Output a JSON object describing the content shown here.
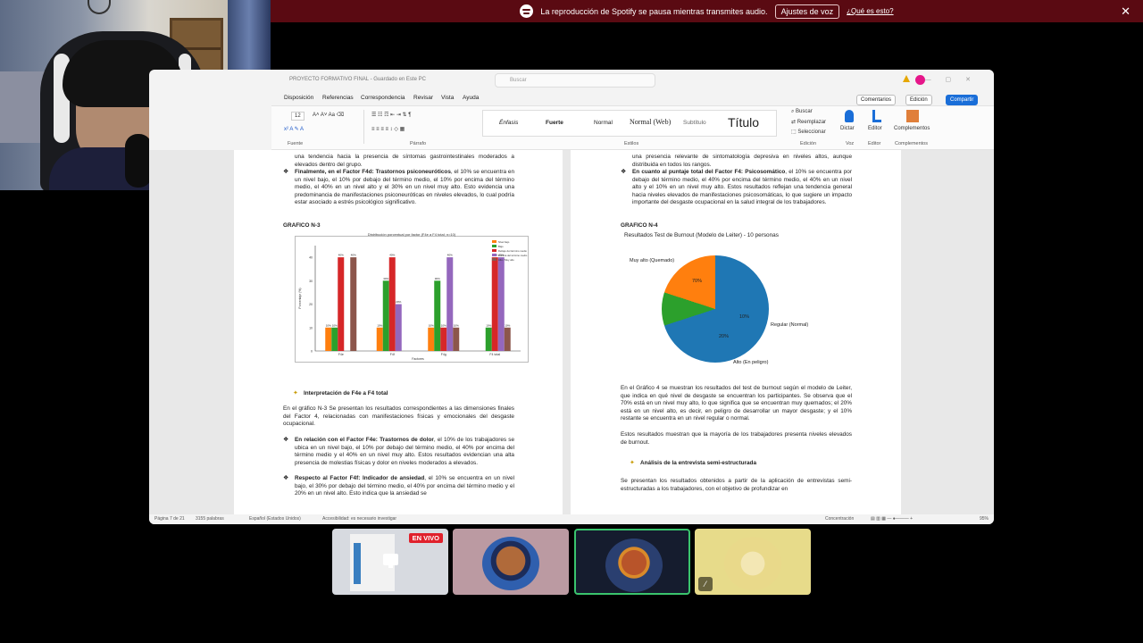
{
  "banner": {
    "message": "La reproducción de Spotify se pausa mientras transmites audio.",
    "voice_settings": "Ajustes de voz",
    "whats_this": "¿Qué es esto?"
  },
  "word": {
    "doc_title": "PROYECTO FORMATIVO FINAL - Guardado en Este PC",
    "search_placeholder": "Buscar",
    "menu": [
      "Disposición",
      "Referencias",
      "Correspondencia",
      "Revisar",
      "Vista",
      "Ayuda"
    ],
    "comments": "Comentarios",
    "editing": "Edición",
    "share": "Compartir",
    "ribbon": {
      "font_size": "12",
      "group_font": "Fuente",
      "group_paragraph": "Párrafo",
      "group_styles": "Estilos",
      "group_editing": "Edición",
      "group_voice": "Voz",
      "group_editor": "Editor",
      "group_addins": "Complementos",
      "styles": [
        "Énfasis",
        "Fuerte",
        "Normal",
        "Normal (Web)",
        "Subtítulo",
        "Título"
      ],
      "find": "Buscar",
      "replace": "Reemplazar",
      "select": "Seleccionar",
      "dictate": "Dictar",
      "editor": "Editor",
      "addins": "Complementos"
    },
    "left_page": {
      "p1": "una tendencia hacia la presencia de síntomas gastrointestinales moderados a elevados dentro del grupo.",
      "p2_bold": "Finalmente, en el Factor F4d: Trastornos psiconeuróticos",
      "p2": ", el 10% se encuentra en un nivel bajo, el 10% por debajo del término medio, el 10% por encima del término medio, el 40% en un nivel alto y el 30% en un nivel muy alto. Esto evidencia una predominancia de manifestaciones psiconeuróticas en niveles elevados, lo cual podría estar asociado a estrés psicológico significativo.",
      "graph_label": "GRAFICO N-3",
      "chart_title": "Distribución porcentual por factor (F4e a F4 total; n=10)",
      "interp_title": "Interpretación de F4e a F4 total",
      "p3": "En el gráfico N-3 Se presentan los resultados correspondientes a las dimensiones finales del Factor 4, relacionadas con manifestaciones físicas y emocionales del desgaste ocupacional.",
      "p4_bold": "En relación con el Factor F4e: Trastornos de dolor",
      "p4": ", el 10% de los trabajadores se ubica en un nivel bajo, el 10% por debajo del término medio, el 40% por encima del término medio y el 40% en un nivel muy alto. Estos resultados evidencian una alta presencia de molestias físicas y dolor en niveles moderados a elevados.",
      "p5_bold": "Respecto al Factor F4f: Indicador de ansiedad",
      "p5": ", el 10% se encuentra en un nivel bajo, el 30% por debajo del término medio, el 40% por encima del término medio y el 20% en un nivel alto. Esto indica que la ansiedad se"
    },
    "right_page": {
      "p1": "una presencia relevante de sintomatología depresiva en niveles altos, aunque distribuida en todos los rangos.",
      "p2_bold": "En cuanto al puntaje total del Factor F4: Psicosomático",
      "p2": ", el 10% se encuentra por debajo del término medio, el 40% por encima del término medio, el 40% en un nivel alto y el 10% en un nivel muy alto. Estos resultados reflejan una tendencia general hacia niveles elevados de manifestaciones psicosomáticas, lo que sugiere un impacto importante del desgaste ocupacional en la salud integral de los trabajadores.",
      "graph_label": "GRAFICO N-4",
      "pie_title": "Resultados Test de Burnout (Modelo de Leiter) - 10 personas",
      "p3": "En el Gráfico 4 se muestran los resultados del test de burnout según el modelo de Leiter, que indica en qué nivel de desgaste se encuentran los participantes. Se observa que el 70% está en un nivel muy alto, lo que significa que se encuentran muy quemados; el 20% está en un nivel alto, es decir, en peligro de desarrollar un mayor desgaste; y el 10% restante se encuentra en un nivel regular o normal.",
      "p4": "Estos resultados muestran que la mayoría de los trabajadores presenta niveles elevados de burnout.",
      "analysis_title": "Análisis de la entrevista semi-estructurada",
      "p5": "Se presentan los resultados obtenidos a partir de la aplicación de entrevistas semi-estructuradas a los trabajadores, con el objetivo de profundizar en"
    },
    "status": {
      "page": "Página 7 de 21",
      "words": "3155 palabras",
      "lang": "Español (Estados Unidos)",
      "accessibility": "Accesibilidad: es necesario investigar",
      "focus": "Concentración",
      "zoom": "95%"
    }
  },
  "chart_data": [
    {
      "type": "bar",
      "title": "Distribución porcentual por factor (F4e a F4 total; n=10)",
      "xlabel": "Factores",
      "ylabel": "Porcentaje (%)",
      "categories": [
        "F4e",
        "F4f",
        "F4g",
        "F4 total"
      ],
      "ylim": [
        0,
        45
      ],
      "series": [
        {
          "name": "Nivel bajo",
          "color": "#ff7f0e",
          "values": [
            10,
            10,
            10,
            0
          ]
        },
        {
          "name": "Bajo",
          "color": "#2ca02c",
          "values": [
            10,
            30,
            30,
            10
          ]
        },
        {
          "name": "Debajo del término medio",
          "color": "#d62728",
          "values": [
            40,
            40,
            10,
            40
          ]
        },
        {
          "name": "Encima del término medio",
          "color": "#9467bd",
          "values": [
            0,
            20,
            40,
            40
          ]
        },
        {
          "name": "Alto / Muy alto",
          "color": "#8c564b",
          "values": [
            40,
            0,
            10,
            10
          ]
        }
      ]
    },
    {
      "type": "pie",
      "title": "Resultados Test de Burnout (Modelo de Leiter) - 10 personas",
      "slices": [
        {
          "label": "Muy alto (Quemado)",
          "value": 70,
          "color": "#1f77b4"
        },
        {
          "label": "Regular (Normal)",
          "value": 10,
          "color": "#2ca02c"
        },
        {
          "label": "Alto (En peligro)",
          "value": 20,
          "color": "#ff7f0e"
        }
      ]
    }
  ],
  "meeting": {
    "live": "EN VIVO"
  }
}
